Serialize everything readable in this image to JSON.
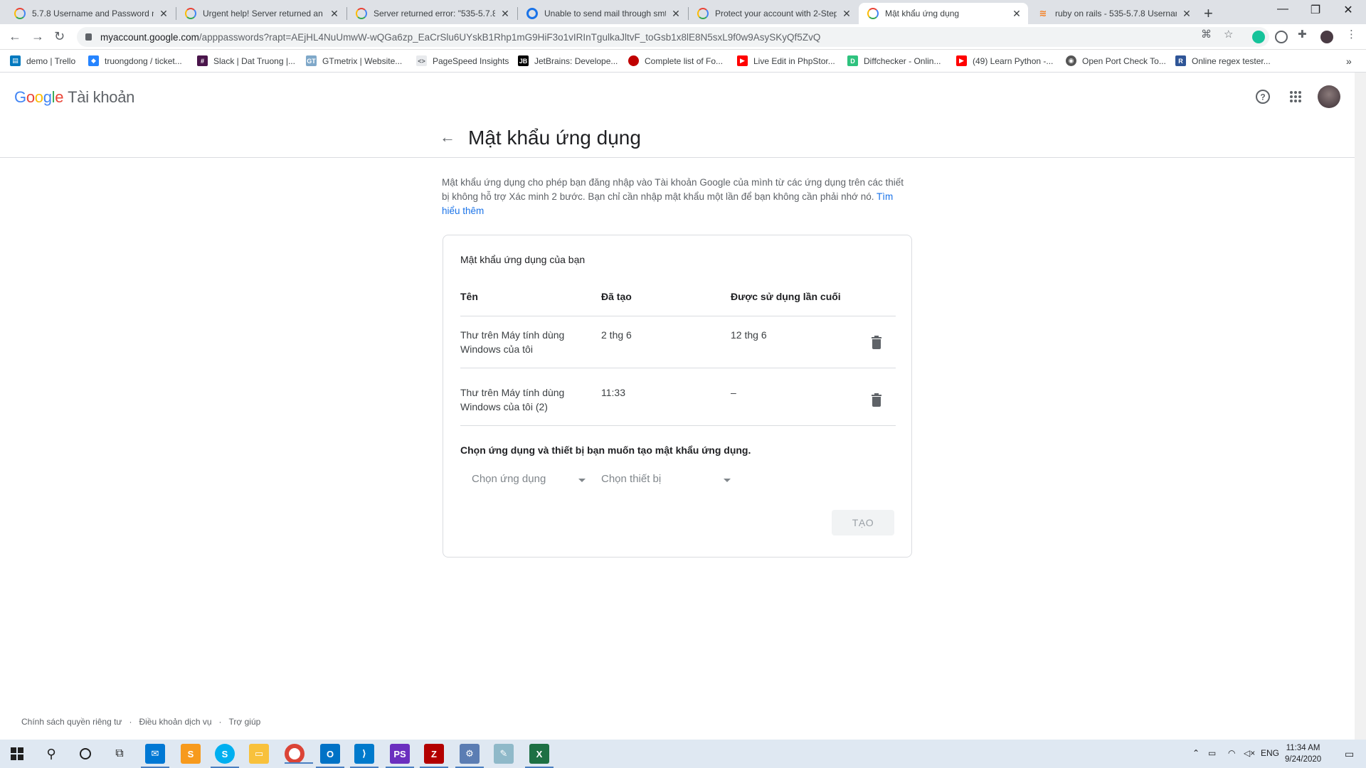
{
  "browser": {
    "tabs": [
      {
        "title": "5.7.8 Username and Password no",
        "favicon": "google-icon"
      },
      {
        "title": "Urgent help! Server returned an e",
        "favicon": "google-icon"
      },
      {
        "title": "Server returned error: \"535-5.7.8",
        "favicon": "google-icon"
      },
      {
        "title": "Unable to send mail through smt",
        "favicon": "loading-icon"
      },
      {
        "title": "Protect your account with 2-Step",
        "favicon": "google-icon"
      },
      {
        "title": "Mật khẩu ứng dụng",
        "favicon": "google-icon",
        "active": true
      },
      {
        "title": "ruby on rails - 535-5.7.8 Usernam",
        "favicon": "stackoverflow-icon"
      }
    ],
    "url_host": "myaccount.google.com",
    "url_path": "/apppasswords?rapt=AEjHL4NuUmwW-wQGa6zp_EaCrSlu6UYskB1Rhp1mG9HiF3o1vIRInTgulkaJltvF_toGsb1x8lE8N5sxL9f0w9AsySKyQf5ZvQ",
    "bookmarks": [
      {
        "label": "demo | Trello",
        "color": "#0079bf",
        "glyph": "▤"
      },
      {
        "label": "truongdong / ticket...",
        "color": "#2684ff",
        "glyph": "◆"
      },
      {
        "label": "Slack | Dat Truong |...",
        "color": "#4a154b",
        "glyph": "#"
      },
      {
        "label": "GTmetrix | Website...",
        "color": "#7fa8c9",
        "glyph": "GT"
      },
      {
        "label": "PageSpeed Insights",
        "color": "#e8eaed",
        "glyph": "<>"
      },
      {
        "label": "JetBrains: Develope...",
        "color": "#000000",
        "glyph": "JB"
      },
      {
        "label": "Complete list of Fo...",
        "color": "#c00000",
        "glyph": "●"
      },
      {
        "label": "Live Edit in PhpStor...",
        "color": "#ff0000",
        "glyph": "▶"
      },
      {
        "label": "Diffchecker - Onlin...",
        "color": "#2ec27e",
        "glyph": "D"
      },
      {
        "label": "(49) Learn Python -...",
        "color": "#ff0000",
        "glyph": "▶"
      },
      {
        "label": "Open Port Check To...",
        "color": "#555555",
        "glyph": "◉"
      },
      {
        "label": "Online regex tester...",
        "color": "#2f5597",
        "glyph": "R"
      }
    ]
  },
  "header": {
    "logo_letters": [
      "G",
      "o",
      "o",
      "g",
      "l",
      "e"
    ],
    "product": "Tài khoản",
    "title": "Mật khẩu ứng dụng"
  },
  "intro": {
    "text": "Mật khẩu ứng dụng cho phép bạn đăng nhập vào Tài khoản Google của mình từ các ứng dụng trên các thiết bị không hỗ trợ Xác minh 2 bước. Bạn chỉ cần nhập mật khẩu một lần để bạn không cần phải nhớ nó.",
    "link": "Tìm hiểu thêm"
  },
  "card": {
    "title": "Mật khẩu ứng dụng của bạn",
    "columns": [
      "Tên",
      "Đã tạo",
      "Được sử dụng lần cuối"
    ],
    "rows": [
      {
        "name": "Thư trên Máy tính dùng Windows của tôi",
        "created": "2 thg 6",
        "last_used": "12 thg 6"
      },
      {
        "name": "Thư trên Máy tính dùng Windows của tôi (2)",
        "created": "11:33",
        "last_used": "–"
      }
    ],
    "select_prompt": "Chọn ứng dụng và thiết bị bạn muốn tạo mật khẩu ứng dụng.",
    "app_select": "Chọn ứng dụng",
    "device_select": "Chọn thiết bị",
    "create_button": "TẠO"
  },
  "footer": {
    "links": [
      "Chính sách quyền riêng tư",
      "Điều khoản dịch vụ",
      "Trợ giúp"
    ]
  },
  "taskbar": {
    "language": "ENG",
    "time": "11:34 AM",
    "date": "9/24/2020"
  }
}
